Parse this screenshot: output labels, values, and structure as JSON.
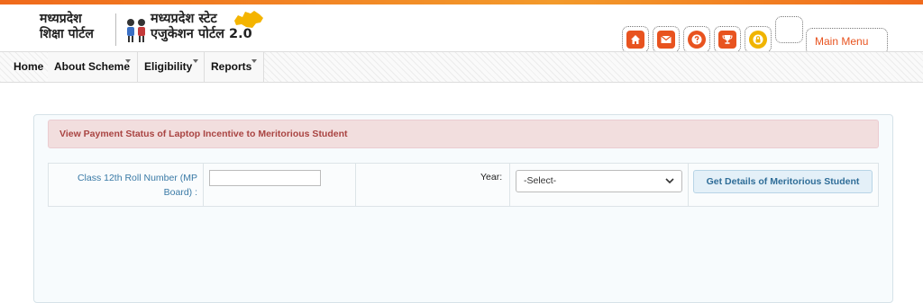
{
  "header": {
    "logo_left_line1": "मध्यप्रदेश",
    "logo_left_line2": "शिक्षा पोर्टल",
    "logo_right_line1": "मध्यप्रदेश स्टेट",
    "logo_right_line2": "एजुकेशन पोर्टल 2.0",
    "icons": [
      "home-icon",
      "mail-icon",
      "help-icon",
      "trophy-icon",
      "lock-icon"
    ],
    "main_menu_label": "Main Menu"
  },
  "nav": {
    "items": [
      {
        "label": "Home"
      },
      {
        "label": "About Scheme"
      },
      {
        "label": "Eligibility"
      },
      {
        "label": "Reports"
      }
    ]
  },
  "form": {
    "alert_title": "View Payment Status of Laptop Incentive to Meritorious Student",
    "roll_label_line1": "Class 12th Roll Number (MP",
    "roll_label_line2": "Board) :",
    "roll_value": "",
    "year_label": "Year:",
    "year_selected": "-Select-",
    "submit_label": "Get Details of Meritorious Student"
  },
  "colors": {
    "accent": "#e8531f",
    "alert_bg": "#f2dede",
    "alert_text": "#a94442",
    "link_blue": "#3a7aa6"
  }
}
